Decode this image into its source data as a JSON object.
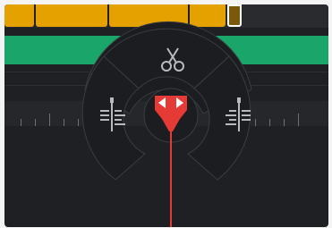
{
  "ui": {
    "title": "",
    "tools": [
      {
        "name": "razor",
        "icon": "scissors-icon"
      },
      {
        "name": "trim-left",
        "icon": "trim-left-icon"
      },
      {
        "name": "trim-right",
        "icon": "trim-right-icon"
      },
      {
        "name": "playhead-handle",
        "icon": "playhead-handle-icon"
      }
    ],
    "colors": {
      "background": "#1f2024",
      "clip_yellow": "#e5a100",
      "clip_dark": "#7a5a08",
      "track_green": "#1aa56a",
      "playhead_red": "#e53a35",
      "menu_bg": "#1c1d20"
    }
  }
}
